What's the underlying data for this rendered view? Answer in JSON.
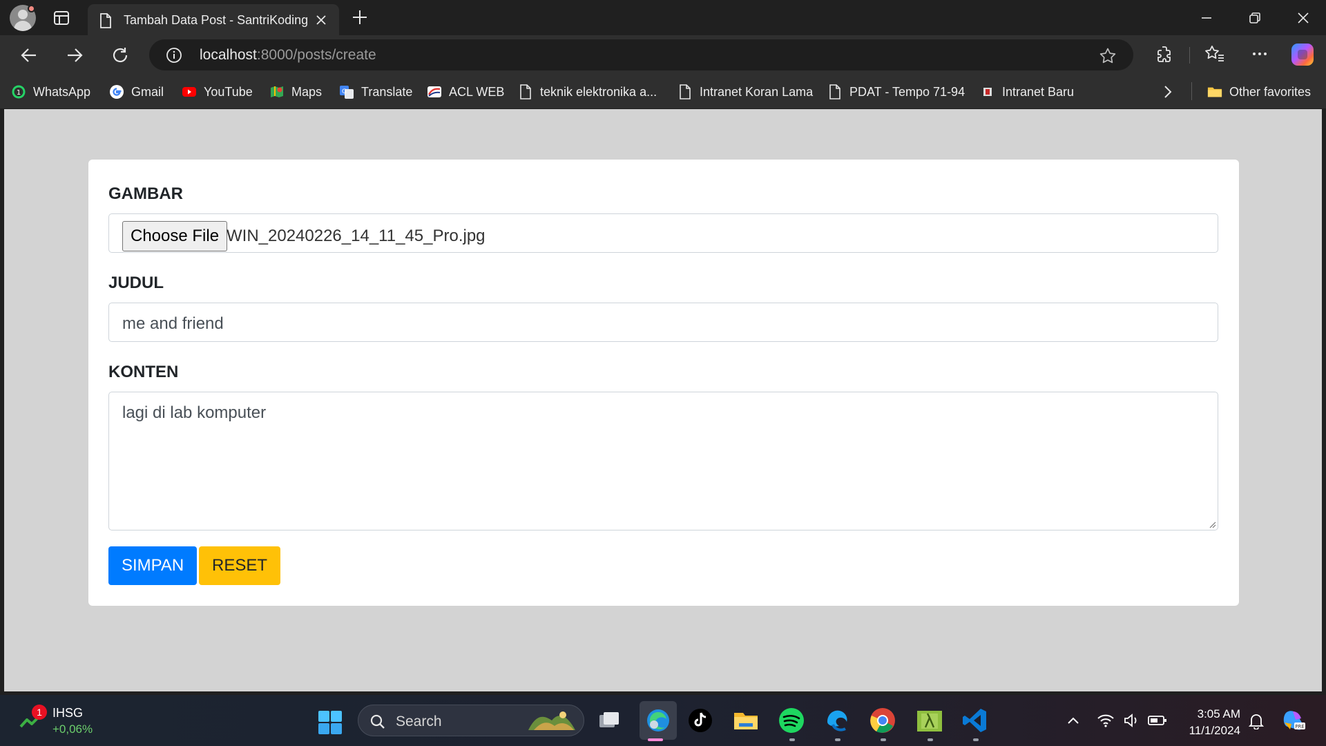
{
  "browser": {
    "tab_title": "Tambah Data Post - SantriKoding",
    "url_host": "localhost",
    "url_path": ":8000/posts/create"
  },
  "favorites": [
    {
      "label": "WhatsApp",
      "icon": "whatsapp-icon"
    },
    {
      "label": "Gmail",
      "icon": "google-icon"
    },
    {
      "label": "YouTube",
      "icon": "youtube-icon"
    },
    {
      "label": "Maps",
      "icon": "maps-icon"
    },
    {
      "label": "Translate",
      "icon": "translate-icon"
    },
    {
      "label": "ACL WEB",
      "icon": "acl-icon"
    },
    {
      "label": "teknik elektronika a...",
      "icon": "page-icon"
    },
    {
      "label": "Intranet Koran Lama",
      "icon": "page-icon"
    },
    {
      "label": "PDAT - Tempo 71-94",
      "icon": "page-icon"
    },
    {
      "label": "Intranet Baru",
      "icon": "intranet-icon"
    }
  ],
  "other_favorites": "Other favorites",
  "form": {
    "image_label": "GAMBAR",
    "choose_file": "Choose File",
    "file_name": "WIN_20240226_14_11_45_Pro.jpg",
    "title_label": "JUDUL",
    "title_value": "me and friend",
    "content_label": "KONTEN",
    "content_value": "lagi di lab komputer",
    "save_label": "SIMPAN",
    "reset_label": "RESET"
  },
  "colors": {
    "primary": "#007bff",
    "warning": "#ffc107",
    "page_bg": "#d3d3d3"
  },
  "taskbar": {
    "stock_badge": "1",
    "stock_name": "IHSG",
    "stock_change": "+0,06%",
    "search_label": "Search",
    "time": "3:05 AM",
    "date": "11/1/2024"
  }
}
